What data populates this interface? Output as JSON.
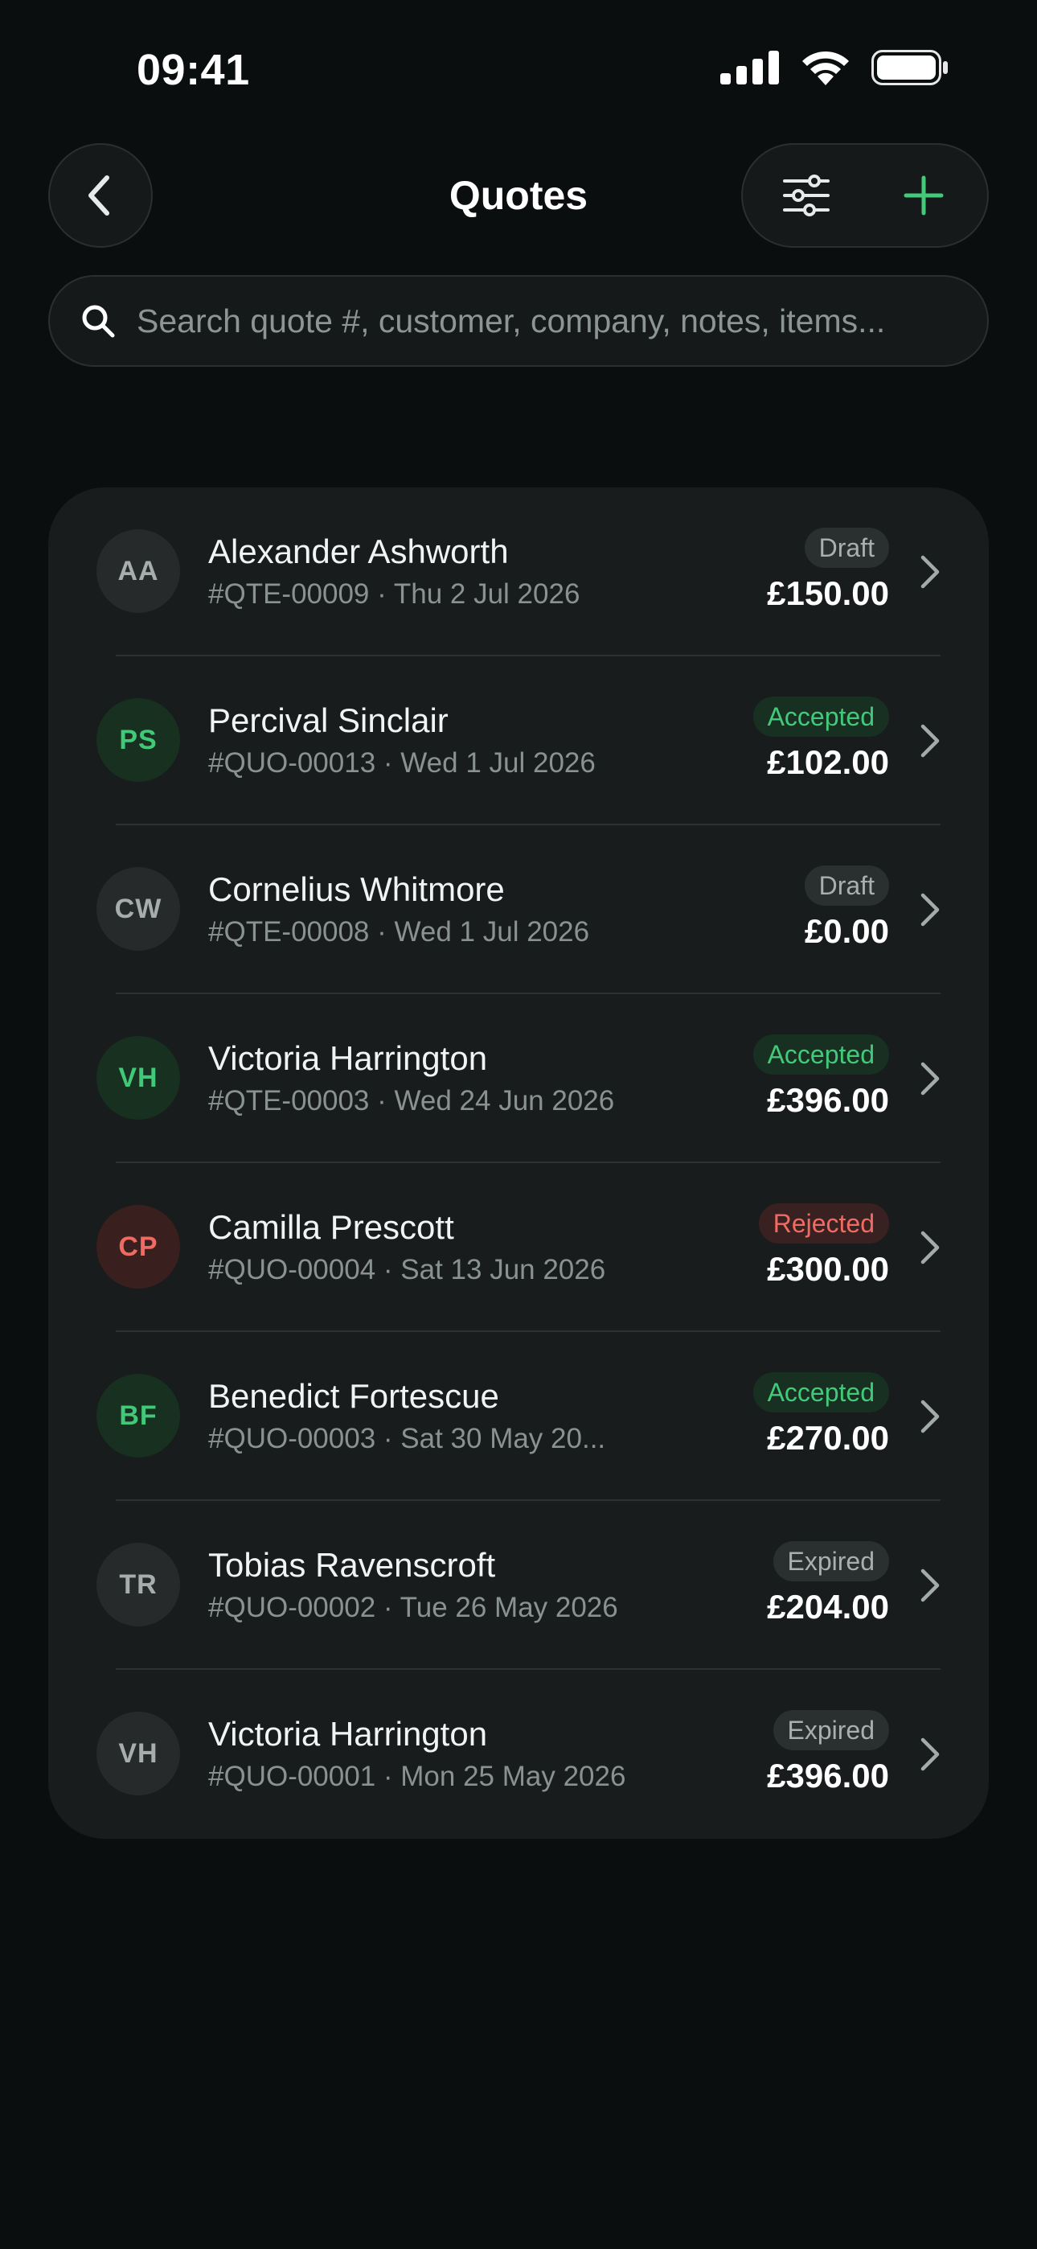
{
  "status_bar": {
    "time": "09:41"
  },
  "header": {
    "title": "Quotes",
    "back_icon": "chevron-left-icon",
    "filter_icon": "sliders-icon",
    "add_icon": "plus-icon"
  },
  "search": {
    "placeholder": "Search quote #, customer, company, notes, items..."
  },
  "colors": {
    "accent": "#43c97a",
    "rejected": "#ef6b63",
    "background": "#0b0e0e",
    "card": "#181c1c"
  },
  "quotes": [
    {
      "initials": "AA",
      "name": "Alexander Ashworth",
      "meta": "#QTE-00009 · Thu 2 Jul 2026",
      "status": "Draft",
      "amount": "£150.00",
      "tone": "neutral"
    },
    {
      "initials": "PS",
      "name": "Percival Sinclair",
      "meta": "#QUO-00013 · Wed 1 Jul 2026",
      "status": "Accepted",
      "amount": "£102.00",
      "tone": "green"
    },
    {
      "initials": "CW",
      "name": "Cornelius Whitmore",
      "meta": "#QTE-00008 · Wed 1 Jul 2026",
      "status": "Draft",
      "amount": "£0.00",
      "tone": "neutral"
    },
    {
      "initials": "VH",
      "name": "Victoria Harrington",
      "meta": "#QTE-00003 · Wed 24 Jun 2026",
      "status": "Accepted",
      "amount": "£396.00",
      "tone": "green"
    },
    {
      "initials": "CP",
      "name": "Camilla Prescott",
      "meta": "#QUO-00004 · Sat 13 Jun 2026",
      "status": "Rejected",
      "amount": "£300.00",
      "tone": "red"
    },
    {
      "initials": "BF",
      "name": "Benedict Fortescue",
      "meta": "#QUO-00003 · Sat 30 May 20...",
      "status": "Accepted",
      "amount": "£270.00",
      "tone": "green"
    },
    {
      "initials": "TR",
      "name": "Tobias Ravenscroft",
      "meta": "#QUO-00002 · Tue 26 May 2026",
      "status": "Expired",
      "amount": "£204.00",
      "tone": "neutral"
    },
    {
      "initials": "VH",
      "name": "Victoria Harrington",
      "meta": "#QUO-00001 · Mon 25 May 2026",
      "status": "Expired",
      "amount": "£396.00",
      "tone": "neutral"
    }
  ]
}
